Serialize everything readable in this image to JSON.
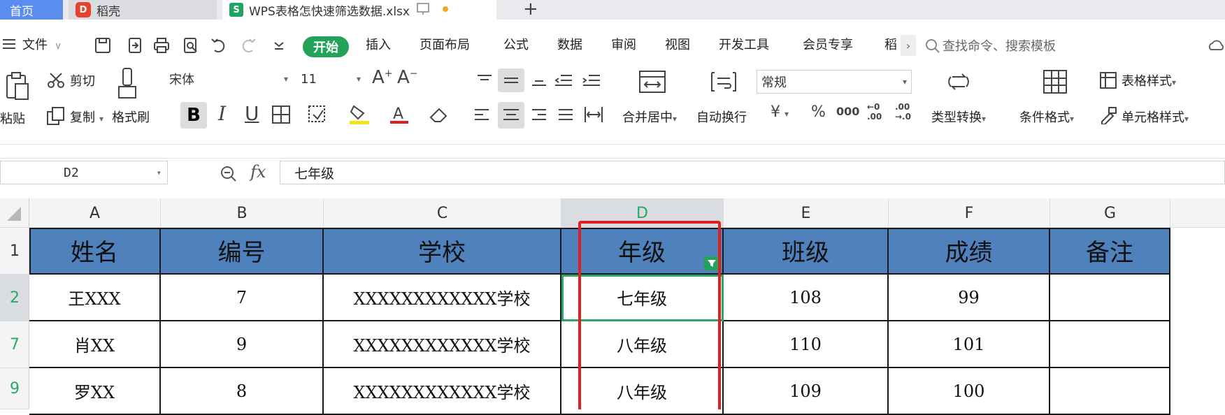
{
  "tabs": {
    "home": "首页",
    "daoke": "稻壳",
    "file": "WPS表格怎快速筛选数据.xlsx"
  },
  "menu": {
    "file": "文件",
    "start": "开始",
    "items": [
      "插入",
      "页面布局",
      "公式",
      "数据",
      "审阅",
      "视图",
      "开发工具",
      "会员专享",
      "稻"
    ],
    "search_placeholder": "查找命令、搜索模板"
  },
  "ribbon": {
    "paste": "粘贴",
    "cut": "剪切",
    "copy": "复制",
    "format_painter": "格式刷",
    "font_name": "宋体",
    "font_size": "11",
    "bold": "B",
    "italic": "I",
    "underline": "U",
    "merge_center": "合并居中",
    "wrap_text": "自动换行",
    "number_format": "常规",
    "currency": "¥",
    "percent": "%",
    "thousands": "000",
    "type_convert": "类型转换",
    "conditional_format": "条件格式",
    "table_style": "表格样式",
    "cell_style": "单元格样式"
  },
  "formula_bar": {
    "cell_ref": "D2",
    "fx": "fx",
    "content": "七年级"
  },
  "grid": {
    "columns": [
      "A",
      "B",
      "C",
      "D",
      "E",
      "F",
      "G"
    ],
    "row_numbers": [
      "1",
      "2",
      "7",
      "9"
    ],
    "headers": [
      "姓名",
      "编号",
      "学校",
      "年级",
      "班级",
      "成绩",
      "备注"
    ],
    "rows": [
      [
        "王XXX",
        "7",
        "XXXXXXXXXXXX学校",
        "七年级",
        "108",
        "99",
        ""
      ],
      [
        "肖XX",
        "9",
        "XXXXXXXXXXXX学校",
        "八年级",
        "110",
        "101",
        ""
      ],
      [
        "罗XX",
        "8",
        "XXXXXXXXXXXX学校",
        "八年级",
        "109",
        "100",
        ""
      ]
    ]
  },
  "colors": {
    "accent_green": "#23a35a",
    "header_blue": "#4f81bd",
    "highlight_red": "#e02020"
  }
}
